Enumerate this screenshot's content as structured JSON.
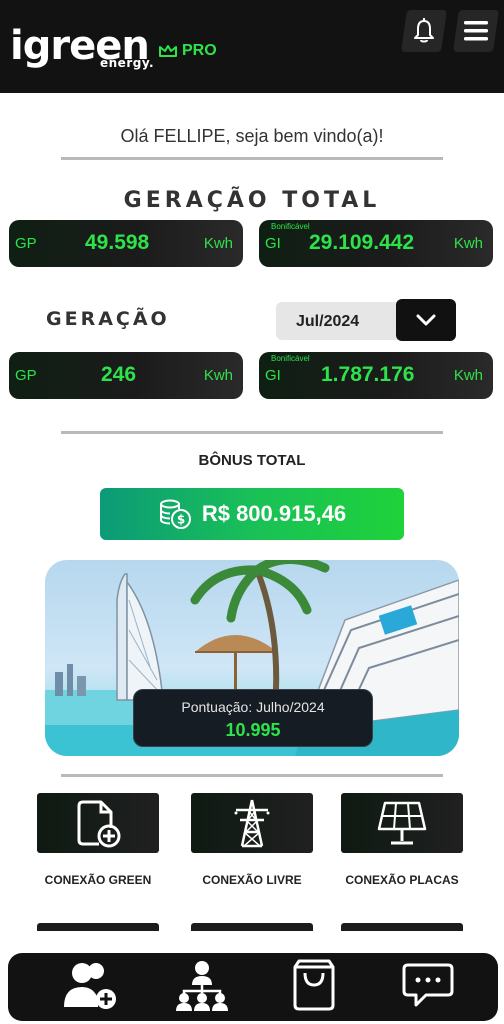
{
  "header": {
    "logo_text": "igreen",
    "logo_sub": "energy.",
    "pro_label": "PRO",
    "icons": {
      "bell": "bell-icon",
      "menu": "hamburger-menu-icon"
    }
  },
  "greeting": "Olá FELLIPE, seja bem vindo(a)!",
  "generation_total": {
    "title": "GERAÇÃO TOTAL",
    "gp": {
      "prefix": "GP",
      "value": "49.598",
      "unit": "Kwh"
    },
    "gi": {
      "tag": "Bonificável",
      "prefix": "GI",
      "value": "29.109.442",
      "unit": "Kwh"
    }
  },
  "generation": {
    "title": "GERAÇÃO",
    "period": "Jul/2024",
    "gp": {
      "prefix": "GP",
      "value": "246",
      "unit": "Kwh"
    },
    "gi": {
      "tag": "Bonificável",
      "prefix": "GI",
      "value": "1.787.176",
      "unit": "Kwh"
    }
  },
  "bonus": {
    "title": "BÔNUS TOTAL",
    "value": "R$ 800.915,46",
    "icon": "coins-icon"
  },
  "score": {
    "label": "Pontuação: Julho/2024",
    "value": "10.995"
  },
  "tiles": [
    {
      "label": "CONEXÃO GREEN",
      "icon": "document-plus-icon"
    },
    {
      "label": "CONEXÃO LIVRE",
      "icon": "power-tower-icon"
    },
    {
      "label": "CONEXÃO PLACAS",
      "icon": "solar-panel-icon"
    }
  ],
  "bottom_nav": [
    {
      "icon": "add-user-icon"
    },
    {
      "icon": "network-icon"
    },
    {
      "icon": "shopping-bag-icon"
    },
    {
      "icon": "chat-icon"
    }
  ],
  "colors": {
    "accent_green": "#2ee34a",
    "header_bg": "#121212",
    "bonus_gradient_start": "#0c9a78",
    "bonus_gradient_end": "#1fd23a"
  }
}
